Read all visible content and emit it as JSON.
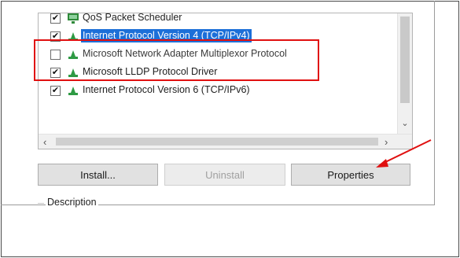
{
  "components_list": {
    "items": [
      {
        "label": "QoS Packet Scheduler",
        "checked": true,
        "icon": "network-service-icon",
        "selected": false
      },
      {
        "label": "Internet Protocol Version 4 (TCP/IPv4)",
        "checked": true,
        "icon": "network-protocol-icon",
        "selected": true
      },
      {
        "label": "Microsoft Network Adapter Multiplexor Protocol",
        "checked": false,
        "icon": "network-protocol-icon",
        "selected": false
      },
      {
        "label": "Microsoft LLDP Protocol Driver",
        "checked": true,
        "icon": "network-protocol-icon",
        "selected": false
      },
      {
        "label": "Internet Protocol Version 6 (TCP/IPv6)",
        "checked": true,
        "icon": "network-protocol-icon",
        "selected": false
      }
    ]
  },
  "buttons": {
    "install": "Install...",
    "uninstall": "Uninstall",
    "properties": "Properties"
  },
  "description": {
    "label": "Description"
  },
  "annotations": {
    "highlight_color": "#e01010",
    "selection_color": "#1c6fd8"
  }
}
